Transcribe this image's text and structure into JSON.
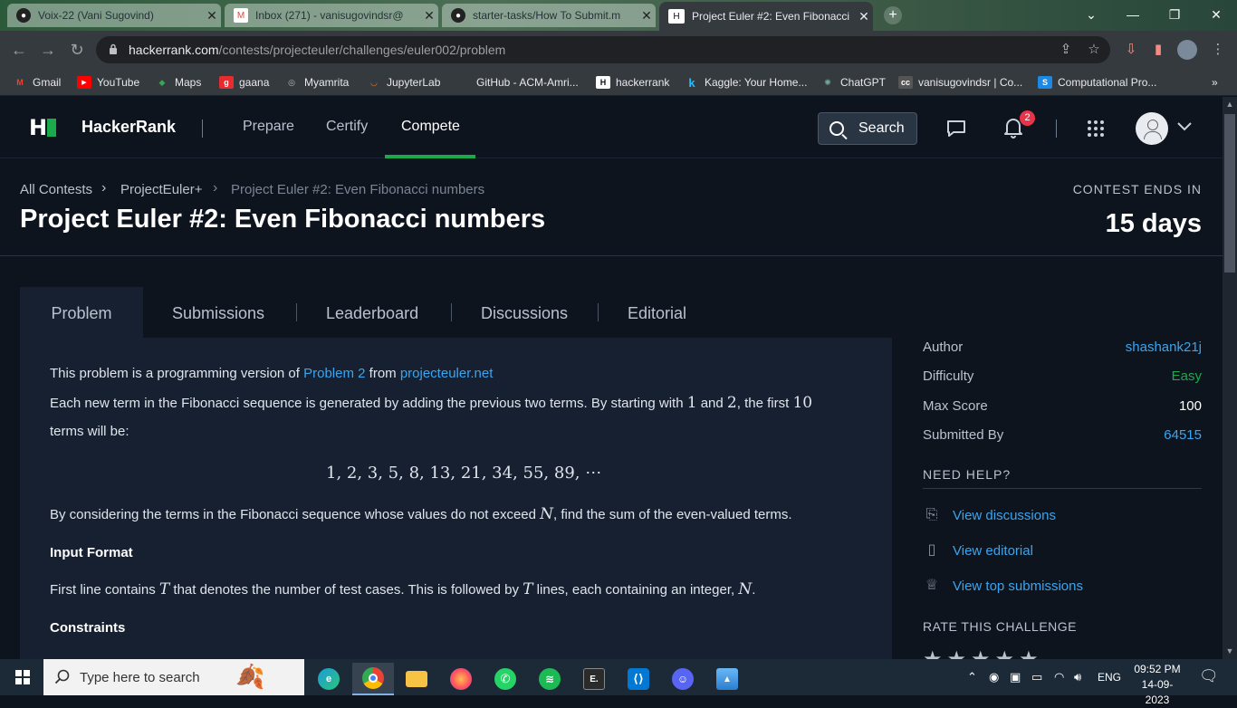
{
  "browser": {
    "tabs": [
      {
        "title": "Voix-22 (Vani Sugovind)",
        "icon": "github-icon"
      },
      {
        "title": "Inbox (271) - vanisugovindsr@",
        "icon": "gmail-icon"
      },
      {
        "title": "starter-tasks/How To Submit.m",
        "icon": "github-icon"
      },
      {
        "title": "Project Euler #2: Even Fibonacci",
        "icon": "hackerrank-icon",
        "active": true
      }
    ],
    "url_domain": "hackerrank.com",
    "url_path": "/contests/projecteuler/challenges/euler002/problem",
    "bookmarks": [
      {
        "label": "Gmail",
        "icon": "M",
        "color": "#ea4335"
      },
      {
        "label": "YouTube",
        "icon": "▶",
        "color": "#ff0000"
      },
      {
        "label": "Maps",
        "icon": "◆",
        "color": "#34a853"
      },
      {
        "label": "gaana",
        "icon": "g",
        "color": "#e72c30"
      },
      {
        "label": "Myamrita",
        "icon": "◎",
        "color": "#888888"
      },
      {
        "label": "JupyterLab",
        "icon": "◡",
        "color": "#f37726"
      },
      {
        "label": "GitHub - ACM-Amri...",
        "icon": "",
        "color": "#353a3f"
      },
      {
        "label": "hackerrank",
        "icon": "H",
        "color": "#1ba94c"
      },
      {
        "label": "Kaggle: Your Home...",
        "icon": "k",
        "color": "#20beff"
      },
      {
        "label": "ChatGPT",
        "icon": "✺",
        "color": "#74aa9c"
      },
      {
        "label": "vanisugovindsr | Co...",
        "icon": "cc",
        "color": "#555555"
      },
      {
        "label": "Computational Pro...",
        "icon": "S",
        "color": "#1e88e5"
      }
    ]
  },
  "header": {
    "brand": "HackerRank",
    "nav": [
      "Prepare",
      "Certify",
      "Compete"
    ],
    "active_nav": "Compete",
    "search_label": "Search",
    "notification_count": "2"
  },
  "breadcrumb": {
    "items": [
      "All Contests",
      "ProjectEuler+",
      "Project Euler #2: Even Fibonacci numbers"
    ]
  },
  "title": "Project Euler #2: Even Fibonacci numbers",
  "contest": {
    "ends_label": "CONTEST ENDS IN",
    "ends_value": "15 days"
  },
  "content_tabs": [
    "Problem",
    "Submissions",
    "Leaderboard",
    "Discussions",
    "Editorial"
  ],
  "problem": {
    "intro_prefix": "This problem is a programming version of ",
    "intro_link1": "Problem 2",
    "intro_mid": " from ",
    "intro_link2": "projecteuler.net",
    "para1_a": "Each new term in the Fibonacci sequence is generated by adding the previous two terms. By starting with ",
    "para1_n1": "1",
    "para1_b": " and ",
    "para1_n2": "2",
    "para1_c": ", the first ",
    "para1_n3": "10",
    "para1_d": "terms will be:",
    "sequence": "1, 2, 3, 5, 8, 13, 21, 34, 55, 89, ⋯",
    "para2_a": "By considering the terms in the Fibonacci sequence whose values do not exceed ",
    "para2_var": "N",
    "para2_b": ", find the sum of the even-valued terms.",
    "input_heading": "Input Format",
    "input_a": "First line contains ",
    "input_var1": "T",
    "input_b": " that denotes the number of test cases. This is followed by ",
    "input_var2": "T",
    "input_c": " lines, each containing an integer, ",
    "input_var3": "N",
    "input_d": ".",
    "constraints_heading": "Constraints"
  },
  "sidebar": {
    "author_label": "Author",
    "author_value": "shashank21j",
    "difficulty_label": "Difficulty",
    "difficulty_value": "Easy",
    "maxscore_label": "Max Score",
    "maxscore_value": "100",
    "submitted_label": "Submitted By",
    "submitted_value": "64515",
    "help_heading": "NEED HELP?",
    "link_discussions": "View discussions",
    "link_editorial": "View editorial",
    "link_top": "View top submissions",
    "rate_heading": "RATE THIS CHALLENGE",
    "colors": {
      "easy": "#1ba94c",
      "link": "#39a5f0"
    }
  },
  "taskbar": {
    "search_placeholder": "Type here to search",
    "language": "ENG",
    "time": "09:52 PM",
    "date": "14-09-2023"
  }
}
